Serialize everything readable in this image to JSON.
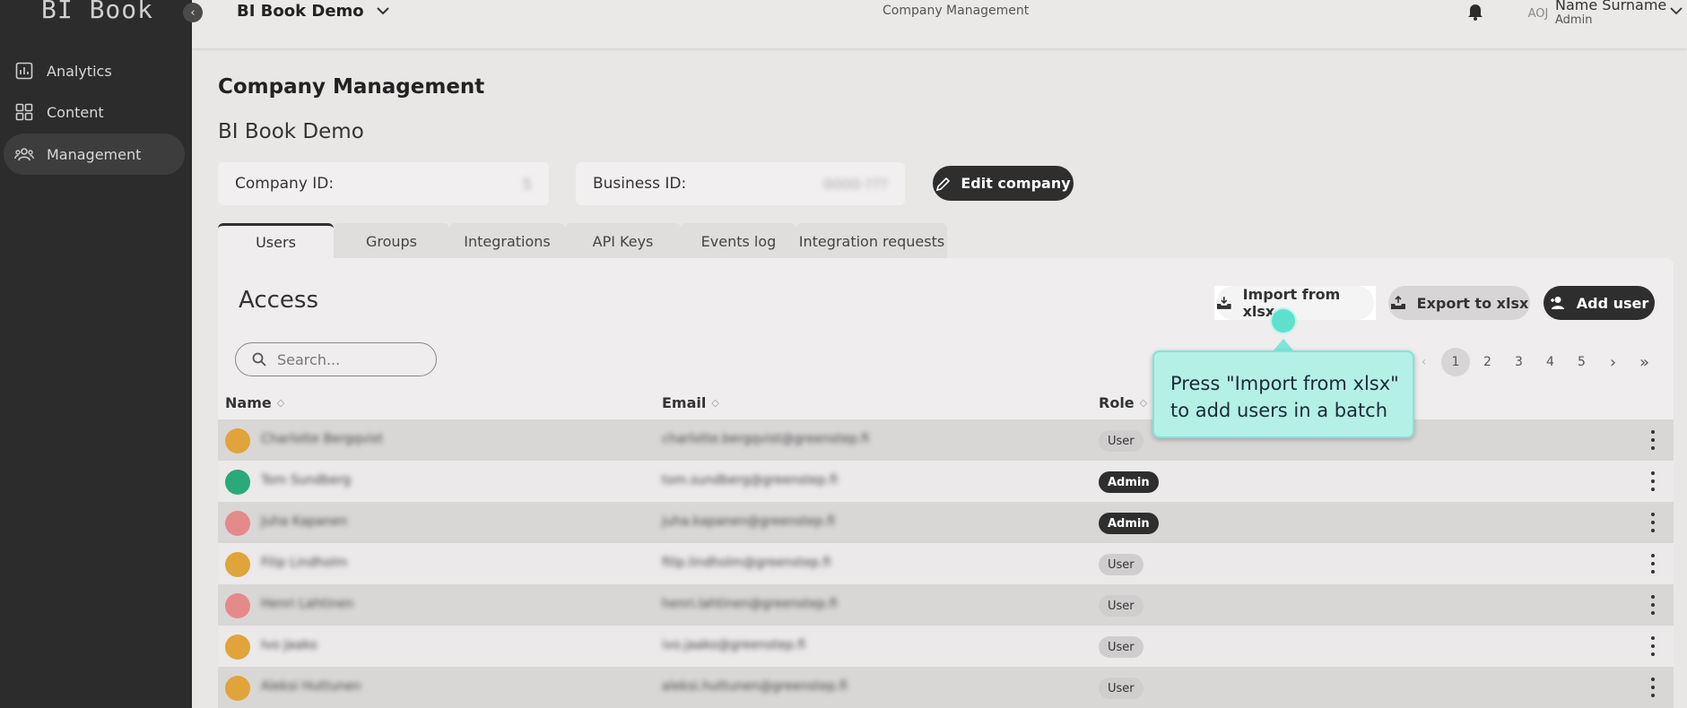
{
  "app": {
    "logo": "BI Book",
    "collapse_icon": "chevron-left-icon"
  },
  "sidebar": {
    "items": [
      {
        "label": "Analytics",
        "icon": "bar-chart-icon",
        "active": false
      },
      {
        "label": "Content",
        "icon": "grid-icon",
        "active": false
      },
      {
        "label": "Management",
        "icon": "users-icon",
        "active": true
      }
    ]
  },
  "header": {
    "company": "BI Book Demo",
    "center_title": "Company Management",
    "user_initials": "AOJ",
    "user_name": "Name Surname",
    "user_role": "Admin"
  },
  "page": {
    "title": "Company Management",
    "company_name": "BI Book Demo",
    "company_id_label": "Company ID:",
    "company_id_value": "5",
    "business_id_label": "Business ID:",
    "business_id_value": "0000-???",
    "edit_button": "Edit company"
  },
  "tabs": [
    {
      "label": "Users",
      "active": true
    },
    {
      "label": "Groups",
      "active": false
    },
    {
      "label": "Integrations",
      "active": false
    },
    {
      "label": "API Keys",
      "active": false
    },
    {
      "label": "Events log",
      "active": false
    },
    {
      "label": "Integration requests",
      "active": false
    }
  ],
  "access": {
    "title": "Access",
    "search_placeholder": "Search...",
    "import_button": "Import from xlsx",
    "export_button": "Export to xlsx",
    "add_button": "Add user",
    "pagination": {
      "pages": [
        "1",
        "2",
        "3",
        "4",
        "5"
      ],
      "current": "1",
      "next": "›",
      "last": "»",
      "prev": "‹"
    },
    "columns": {
      "name": "Name",
      "email": "Email",
      "role": "Role"
    },
    "rows": [
      {
        "name": "Charlotte Bergqvist",
        "email": "charlotte.bergqvist@greenstep.fi",
        "role": "User",
        "avatar_color": "#e0a43a"
      },
      {
        "name": "Tom Sundberg",
        "email": "tom.sundberg@greenstep.fi",
        "role": "Admin",
        "avatar_color": "#2aa97a"
      },
      {
        "name": "Juha Kapanen",
        "email": "juha.kapanen@greenstep.fi",
        "role": "Admin",
        "avatar_color": "#e58a8a"
      },
      {
        "name": "Filip Lindholm",
        "email": "filip.lindholm@greenstep.fi",
        "role": "User",
        "avatar_color": "#e0a43a"
      },
      {
        "name": "Henri Lahtinen",
        "email": "henri.lahtinen@greenstep.fi",
        "role": "User",
        "avatar_color": "#e58a8a"
      },
      {
        "name": "Ivo Jaako",
        "email": "ivo.jaako@greenstep.fi",
        "role": "User",
        "avatar_color": "#e0a43a"
      },
      {
        "name": "Aleksi Huttunen",
        "email": "aleksi.huttunen@greenstep.fi",
        "role": "User",
        "avatar_color": "#e0a43a"
      }
    ]
  },
  "callout": {
    "line1": "Press \"Import from xlsx\"",
    "line2": "to add users in a batch",
    "color": "#b4f0e6"
  }
}
